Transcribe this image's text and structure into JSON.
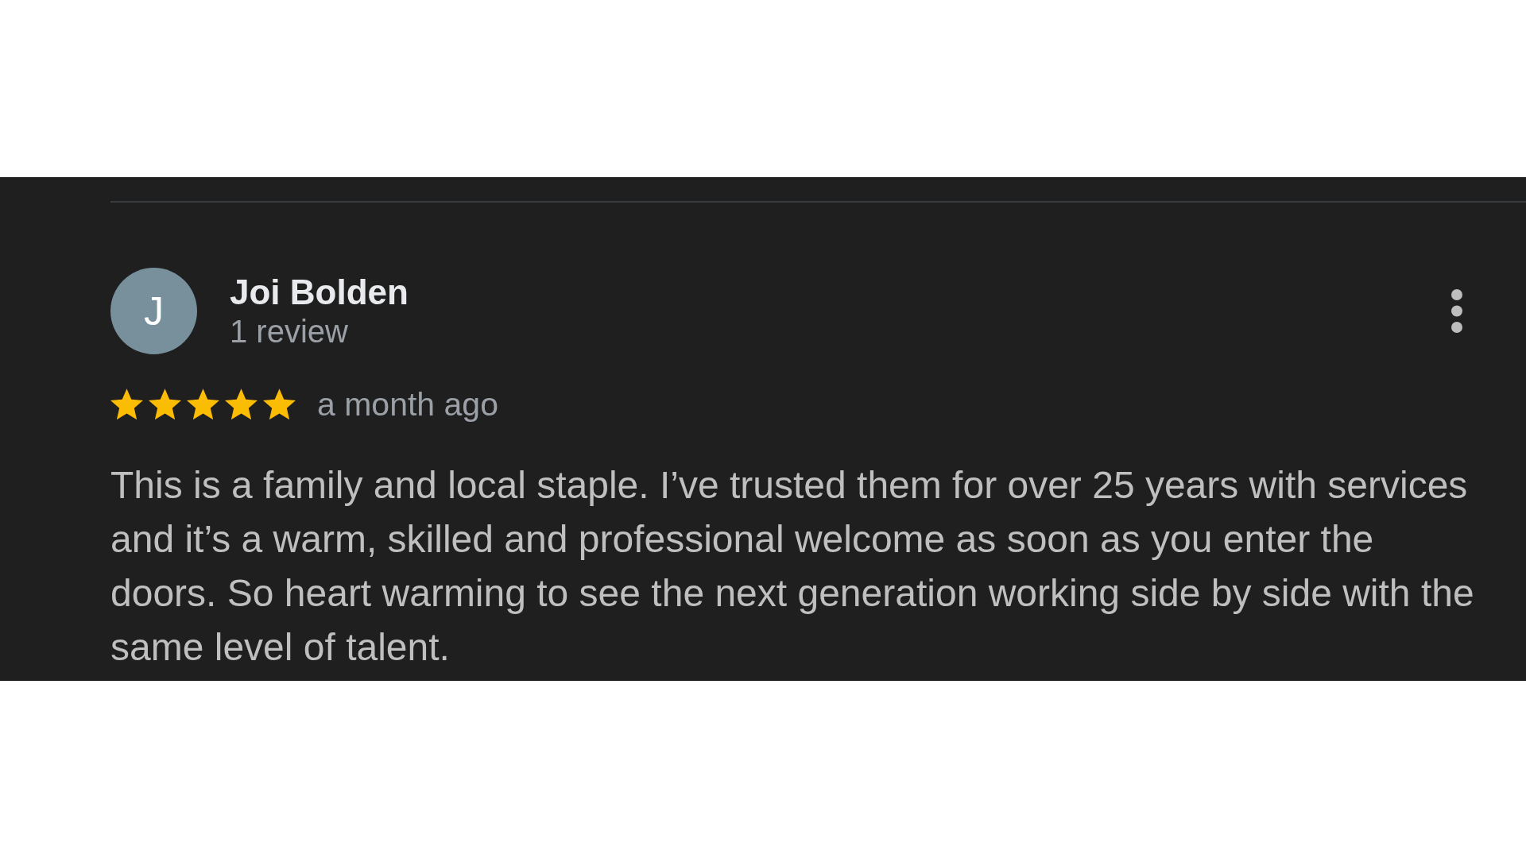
{
  "review": {
    "reviewer": {
      "initial": "J",
      "name": "Joi Bolden",
      "review_count": "1 review"
    },
    "rating": {
      "stars": 5,
      "time": "a month ago"
    },
    "text": "This is a family and local staple. I’ve trusted them for over 25 years with services and it’s a warm, skilled and professional welcome as soon as you enter the doors. So heart warming to see the next generation working side by side with the same level of talent."
  }
}
